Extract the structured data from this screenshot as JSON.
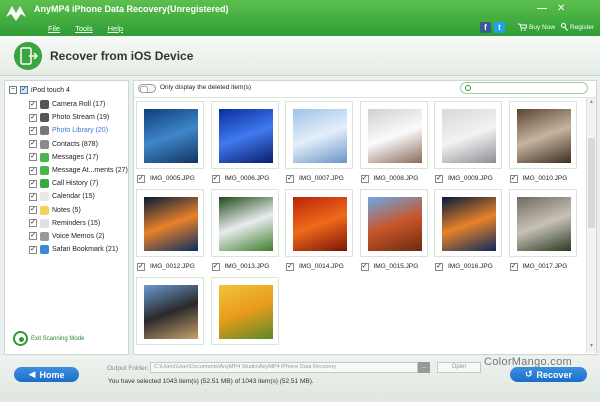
{
  "window": {
    "title": "AnyMP4 iPhone Data Recovery(Unregistered)",
    "menu": [
      "File",
      "Tools",
      "Help"
    ],
    "buy_now": "Buy Now",
    "register": "Register",
    "minimize": "—",
    "close": "✕"
  },
  "header": {
    "title": "Recover from iOS Device"
  },
  "sidebar": {
    "device": "iPod touch 4",
    "items": [
      {
        "label": "Camera Roll (17)",
        "icon": "camera-icon",
        "color": "#555555"
      },
      {
        "label": "Photo Stream (19)",
        "icon": "photo-stream-icon",
        "color": "#555555"
      },
      {
        "label": "Photo Library (20)",
        "icon": "photo-library-icon",
        "color": "#777777"
      },
      {
        "label": "Contacts (878)",
        "icon": "contacts-icon",
        "color": "#8a8a8a"
      },
      {
        "label": "Messages (17)",
        "icon": "messages-icon",
        "color": "#4bb54b"
      },
      {
        "label": "Message At...ments (27)",
        "icon": "message-attachments-icon",
        "color": "#4bb54b"
      },
      {
        "label": "Call History (7)",
        "icon": "call-history-icon",
        "color": "#3aa83a"
      },
      {
        "label": "Calendar (15)",
        "icon": "calendar-icon",
        "color": "#e8e8e8"
      },
      {
        "label": "Notes (5)",
        "icon": "notes-icon",
        "color": "#f5d25a"
      },
      {
        "label": "Reminders (15)",
        "icon": "reminders-icon",
        "color": "#e0e0e0"
      },
      {
        "label": "Voice Memos (2)",
        "icon": "voice-memos-icon",
        "color": "#999999"
      },
      {
        "label": "Safari Bookmark (21)",
        "icon": "safari-icon",
        "color": "#3b87d8"
      }
    ],
    "exit_label": "Exit Scanning Mode"
  },
  "toolbar": {
    "toggle_label": "Only display the deleted item(s)",
    "search_placeholder": ""
  },
  "photos": [
    {
      "name": "IMG_0005.JPG",
      "colors": [
        "#0d3f7a",
        "#3f86c9",
        "#12345f"
      ]
    },
    {
      "name": "IMG_0006.JPG",
      "colors": [
        "#0a2e9e",
        "#3f7af0",
        "#0b1c6a"
      ]
    },
    {
      "name": "IMG_0007.JPG",
      "colors": [
        "#9fc2ea",
        "#e4effa",
        "#6b93c8"
      ]
    },
    {
      "name": "IMG_0008.JPG",
      "colors": [
        "#d0d0d0",
        "#fbfbfb",
        "#8a6a5a"
      ]
    },
    {
      "name": "IMG_0009.JPG",
      "colors": [
        "#d7d9dc",
        "#f2f2f2",
        "#8c8f93"
      ]
    },
    {
      "name": "IMG_0010.JPG",
      "colors": [
        "#5a4433",
        "#c6b49e",
        "#3b2d22"
      ]
    },
    {
      "name": "IMG_0012.JPG",
      "colors": [
        "#041a3a",
        "#e8822a",
        "#0a2d60"
      ]
    },
    {
      "name": "IMG_0013.JPG",
      "colors": [
        "#1f4a1a",
        "#e9ecef",
        "#3f7d2a"
      ]
    },
    {
      "name": "IMG_0014.JPG",
      "colors": [
        "#b8240a",
        "#f06a1a",
        "#7a1408"
      ]
    },
    {
      "name": "IMG_0015.JPG",
      "colors": [
        "#6aa8e8",
        "#c9562a",
        "#6e2a12"
      ]
    },
    {
      "name": "IMG_0016.JPG",
      "colors": [
        "#031a3a",
        "#e8822a",
        "#0c2a5a"
      ]
    },
    {
      "name": "IMG_0017.JPG",
      "colors": [
        "#6f6a62",
        "#c8c2b6",
        "#2a3a22"
      ]
    },
    {
      "name": "",
      "colors": [
        "#6a9ad0",
        "#2a2a2a",
        "#c8a070"
      ]
    },
    {
      "name": "",
      "colors": [
        "#f3c23a",
        "#e89b1a",
        "#5a8a2a"
      ]
    }
  ],
  "footer": {
    "home_label": "Home",
    "recover_label": "Recover",
    "output_label": "Output Folder:",
    "output_path": "C:\\Users\\User\\Documents\\AnyMP4 Studio\\AnyMP4 iPhone Data Recovery",
    "browse_label": "...",
    "open_label": "Open",
    "selection_info": "You have selected 1043 item(s) (52.51 MB) of 1043 item(s) (52.51 MB)."
  },
  "watermark": "ColorMango.com"
}
